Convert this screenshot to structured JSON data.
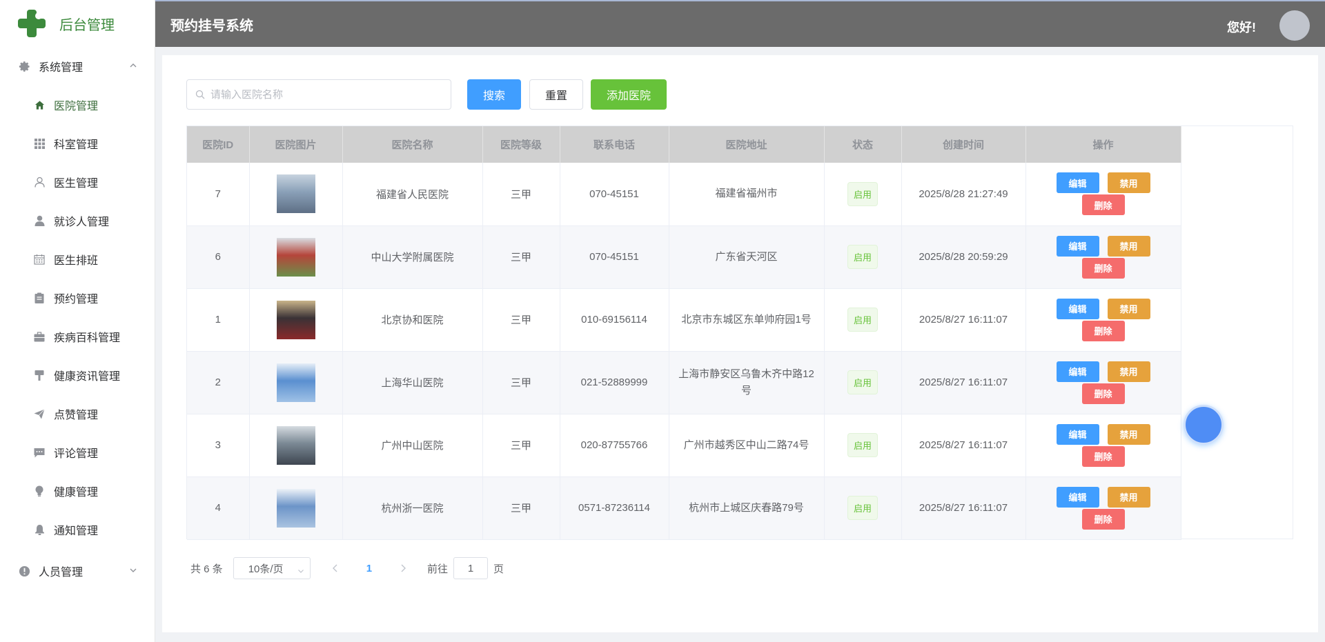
{
  "app": {
    "logo_text": "后台管理",
    "brand_color": "#3c8a3c"
  },
  "sidebar": {
    "group_system": {
      "label": "系统管理",
      "icon": "gear-icon"
    },
    "items": [
      {
        "label": "医院管理",
        "icon": "home-icon",
        "active": true
      },
      {
        "label": "科室管理",
        "icon": "grid-icon"
      },
      {
        "label": "医生管理",
        "icon": "user-outline-icon"
      },
      {
        "label": "就诊人管理",
        "icon": "user-solid-icon"
      },
      {
        "label": "医生排班",
        "icon": "calendar-icon"
      },
      {
        "label": "预约管理",
        "icon": "clipboard-icon"
      },
      {
        "label": "疾病百科管理",
        "icon": "suitcase-icon"
      },
      {
        "label": "健康资讯管理",
        "icon": "signpost-icon"
      },
      {
        "label": "点赞管理",
        "icon": "paper-plane-icon"
      },
      {
        "label": "评论管理",
        "icon": "chat-icon"
      },
      {
        "label": "健康管理",
        "icon": "bulb-icon"
      },
      {
        "label": "通知管理",
        "icon": "bell-icon"
      }
    ],
    "group_people": {
      "label": "人员管理",
      "icon": "info-icon"
    }
  },
  "header": {
    "title": "预约挂号系统",
    "greeting": "您好!"
  },
  "toolbar": {
    "search_placeholder": "请输入医院名称",
    "search_label": "搜索",
    "reset_label": "重置",
    "add_label": "添加医院"
  },
  "table": {
    "columns": [
      "医院ID",
      "医院图片",
      "医院名称",
      "医院等级",
      "联系电话",
      "医院地址",
      "状态",
      "创建时间",
      "操作"
    ],
    "rows": [
      {
        "id": "7",
        "name": "福建省人民医院",
        "level": "三甲",
        "phone": "070-45151",
        "address": "福建省福州市",
        "status": "启用",
        "created": "2025/8/28 21:27:49"
      },
      {
        "id": "6",
        "name": "中山大学附属医院",
        "level": "三甲",
        "phone": "070-45151",
        "address": "广东省天河区",
        "status": "启用",
        "created": "2025/8/28 20:59:29"
      },
      {
        "id": "1",
        "name": "北京协和医院",
        "level": "三甲",
        "phone": "010-69156114",
        "address": "北京市东城区东单帅府园1号",
        "status": "启用",
        "created": "2025/8/27 16:11:07"
      },
      {
        "id": "2",
        "name": "上海华山医院",
        "level": "三甲",
        "phone": "021-52889999",
        "address": "上海市静安区乌鲁木齐中路12号",
        "status": "启用",
        "created": "2025/8/27 16:11:07"
      },
      {
        "id": "3",
        "name": "广州中山医院",
        "level": "三甲",
        "phone": "020-87755766",
        "address": "广州市越秀区中山二路74号",
        "status": "启用",
        "created": "2025/8/27 16:11:07"
      },
      {
        "id": "4",
        "name": "杭州浙一医院",
        "level": "三甲",
        "phone": "0571-87236114",
        "address": "杭州市上城区庆春路79号",
        "status": "启用",
        "created": "2025/8/27 16:11:07"
      }
    ],
    "ops": {
      "edit": "编辑",
      "disable": "禁用",
      "delete": "删除"
    }
  },
  "pagination": {
    "total_text": "共 6 条",
    "page_size": "10条/页",
    "current_page": "1",
    "goto_prefix": "前往",
    "goto_value": "1",
    "goto_suffix": "页"
  }
}
